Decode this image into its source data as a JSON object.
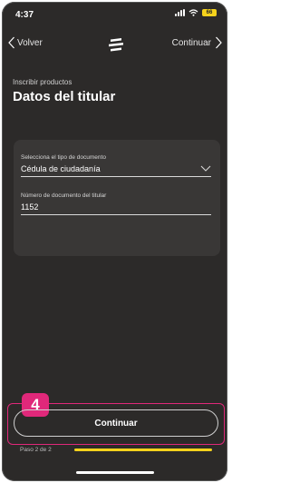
{
  "status_bar": {
    "time": "4:37",
    "battery_label": "66",
    "battery_color": "#f5d21c"
  },
  "nav": {
    "back_label": "Volver",
    "next_label": "Continuar"
  },
  "header": {
    "subtitle": "Inscribir productos",
    "title": "Datos del titular"
  },
  "form": {
    "document_type": {
      "label": "Selecciona el tipo de documento",
      "value": "Cédula de ciudadanía"
    },
    "document_number": {
      "label": "Número de documento del titular",
      "value": "1152"
    }
  },
  "step_badge": "4",
  "footer": {
    "continue_label": "Continuar",
    "progress_label": "Paso 2 de 2",
    "progress_fraction": 1.0,
    "accent_color": "#f5d21c",
    "highlight_color": "#e0287a"
  }
}
